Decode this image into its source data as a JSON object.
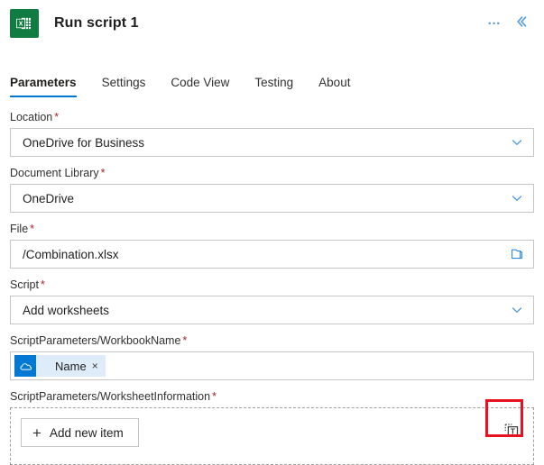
{
  "header": {
    "app_icon": "excel-icon",
    "title": "Run script 1",
    "more_label": "…",
    "collapse_label": "«",
    "accent_color": "#0078d4",
    "excel_green": "#107C41"
  },
  "tabs": [
    {
      "label": "Parameters",
      "active": true
    },
    {
      "label": "Settings",
      "active": false
    },
    {
      "label": "Code View",
      "active": false
    },
    {
      "label": "Testing",
      "active": false
    },
    {
      "label": "About",
      "active": false
    }
  ],
  "fields": [
    {
      "name": "location",
      "label": "Location",
      "required": "*",
      "value": "OneDrive for Business",
      "adornment": "chevron-down-icon"
    },
    {
      "name": "document-library",
      "label": "Document Library",
      "required": "*",
      "value": "OneDrive",
      "adornment": "chevron-down-icon"
    },
    {
      "name": "file",
      "label": "File",
      "required": "*",
      "value": "/Combination.xlsx",
      "adornment": "folder-open-icon"
    },
    {
      "name": "script",
      "label": "Script",
      "required": "*",
      "value": "Add worksheets",
      "adornment": "chevron-down-icon"
    }
  ],
  "workbook_name": {
    "label": "ScriptParameters/WorkbookName",
    "required": "*",
    "token": {
      "icon": "onedrive-cloud-icon",
      "text": "Name",
      "remove_label": "×"
    }
  },
  "worksheet_information": {
    "label": "ScriptParameters/WorksheetInformation",
    "required": "*",
    "add_button_label": "Add new item",
    "add_button_icon": "plus-icon",
    "toggle_input_icon": "switch-to-text-input-icon",
    "highlight_color": "#e81123"
  }
}
